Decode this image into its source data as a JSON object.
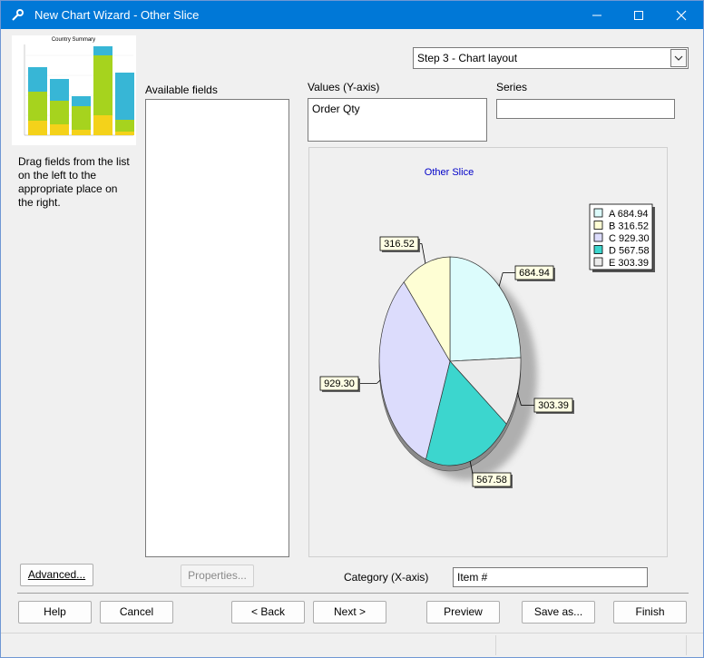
{
  "window": {
    "title": "New Chart Wizard - Other Slice"
  },
  "step_selector": {
    "value": "Step 3 - Chart layout"
  },
  "instructions": "Drag fields from the list on the left to the appropriate place on the right.",
  "thumbnail": {
    "title": "Country Summary"
  },
  "available_fields": {
    "label": "Available fields"
  },
  "values_axis": {
    "label": "Values (Y-axis)",
    "item": "Order Qty"
  },
  "series": {
    "label": "Series",
    "value": ""
  },
  "category": {
    "label": "Category (X-axis)",
    "value": "Item #"
  },
  "buttons": {
    "advanced": "Advanced...",
    "properties": "Properties...",
    "help": "Help",
    "cancel": "Cancel",
    "back": "< Back",
    "next": "Next >",
    "preview": "Preview",
    "save_as": "Save as...",
    "finish": "Finish"
  },
  "chart_data": {
    "type": "pie",
    "title": "Other Slice",
    "categories": [
      "A",
      "B",
      "C",
      "D",
      "E"
    ],
    "values": [
      684.94,
      316.52,
      929.3,
      567.58,
      303.39
    ],
    "value_labels": [
      "684.94",
      "316.52",
      "929.30",
      "567.58",
      "303.39"
    ],
    "legend": [
      "A 684.94",
      "B 316.52",
      "C 929.30",
      "D 567.58",
      "E 303.39"
    ],
    "colors": [
      "#dcfcfc",
      "#fefed4",
      "#dcdcfc",
      "#3cd6ce",
      "#ececec"
    ],
    "legend_placement": "top-right"
  }
}
